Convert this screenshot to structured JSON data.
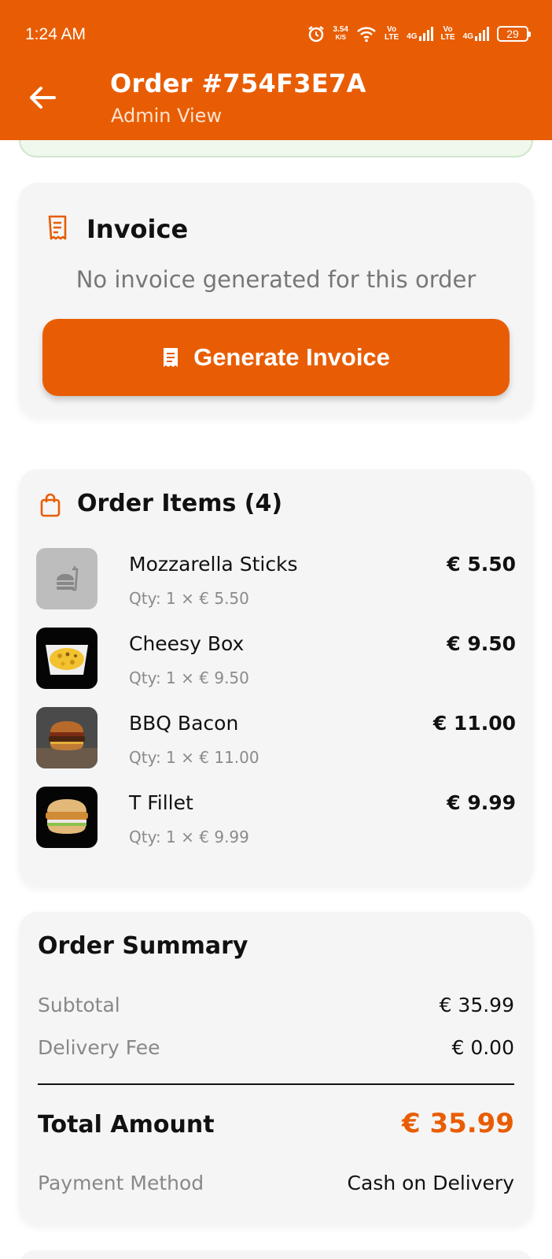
{
  "status_bar": {
    "time": "1:24 AM",
    "speed": "3.54",
    "speed_unit": "K/S",
    "net1_top": "Vo",
    "net1_bottom": "LTE",
    "net1_gen": "4G",
    "net2_top": "Vo",
    "net2_bottom": "LTE",
    "net2_gen": "4G",
    "battery": "29"
  },
  "header": {
    "title": "Order #754F3E7A",
    "subtitle": "Admin View",
    "back_icon": "arrow-left-icon"
  },
  "invoice": {
    "title": "Invoice",
    "icon": "receipt-icon",
    "empty_message": "No invoice generated for this order",
    "button_label": "Generate Invoice"
  },
  "order_items": {
    "title": "Order Items (4)",
    "icon": "shopping-bag-icon",
    "items": [
      {
        "name": "Mozzarella Sticks",
        "qty": "Qty: 1 × € 5.50",
        "price": "€ 5.50",
        "image": "placeholder-food-icon"
      },
      {
        "name": "Cheesy Box",
        "qty": "Qty: 1 × € 9.50",
        "price": "€ 9.50",
        "image": "cheesy-box-photo"
      },
      {
        "name": "BBQ Bacon",
        "qty": "Qty: 1 × € 11.00",
        "price": "€ 11.00",
        "image": "bbq-bacon-photo"
      },
      {
        "name": "T Fillet",
        "qty": "Qty: 1 × € 9.99",
        "price": "€ 9.99",
        "image": "t-fillet-photo"
      }
    ]
  },
  "summary": {
    "title": "Order Summary",
    "subtotal_label": "Subtotal",
    "subtotal_value": "€ 35.99",
    "delivery_label": "Delivery Fee",
    "delivery_value": "€ 0.00",
    "total_label": "Total Amount",
    "total_value": "€ 35.99",
    "payment_label": "Payment Method",
    "payment_value": "Cash on Delivery"
  },
  "colors": {
    "accent": "#E85D04",
    "card_bg": "#F5F5F5",
    "muted_text": "#888888"
  }
}
